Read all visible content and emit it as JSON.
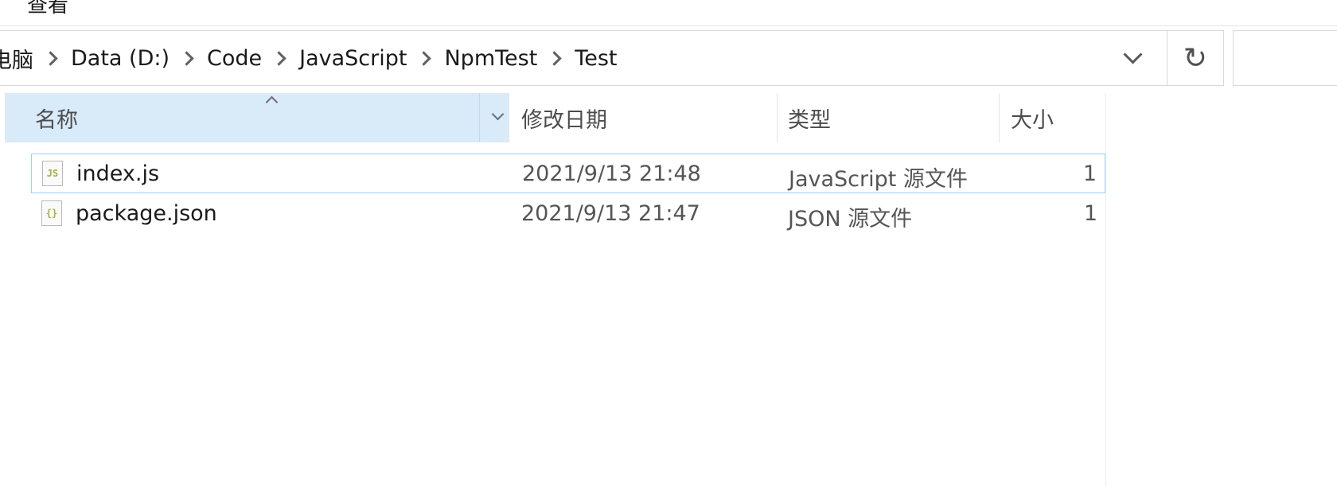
{
  "ribbon": {
    "view_tab": "查看"
  },
  "address_bar": {
    "breadcrumbs": [
      "电脑",
      "Data (D:)",
      "Code",
      "JavaScript",
      "NpmTest",
      "Test"
    ],
    "dropdown_icon": "chevron-down-icon",
    "refresh_icon": "refresh-icon",
    "refresh_glyph": "↻"
  },
  "columns": {
    "name": "名称",
    "date": "修改日期",
    "type": "类型",
    "size": "大小",
    "sort": "ascending"
  },
  "files": [
    {
      "name": "index.js",
      "icon": "javascript-file-icon",
      "icon_label": "JS",
      "modified": "2021/9/13 21:48",
      "type": "JavaScript 源文件",
      "size": "1"
    },
    {
      "name": "package.json",
      "icon": "json-file-icon",
      "icon_label": "{}",
      "modified": "2021/9/13 21:47",
      "type": "JSON 源文件",
      "size": "1"
    }
  ],
  "colors": {
    "selected_header": "#d9eaf9",
    "focus_border": "#99d1ff",
    "file_icon_accent": "#a4b33a"
  }
}
